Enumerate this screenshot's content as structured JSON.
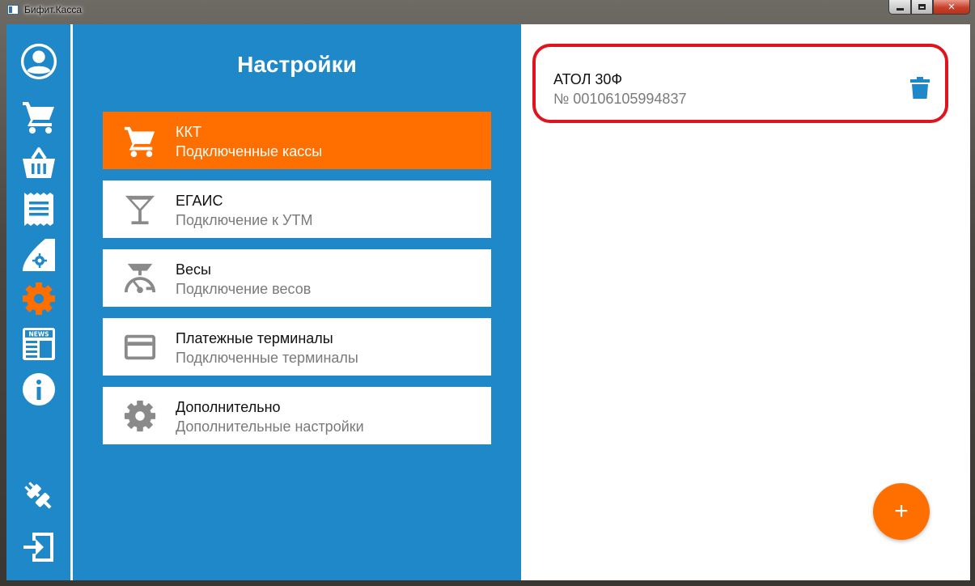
{
  "window": {
    "title": "Бифит.Касса",
    "close_glyph": "✕"
  },
  "colors": {
    "primary": "#1e88c8",
    "accent": "#ff6f00",
    "highlight": "#e0141e",
    "muted_text": "#7a7a7a"
  },
  "sidebar": {
    "items": [
      {
        "icon": "account-icon",
        "active": false
      },
      {
        "icon": "cart-icon",
        "active": false
      },
      {
        "icon": "basket-icon",
        "active": false
      },
      {
        "icon": "receipt-icon",
        "active": false
      },
      {
        "icon": "reports-icon",
        "active": false
      },
      {
        "icon": "gear-icon",
        "active": true
      },
      {
        "icon": "news-icon",
        "active": false
      },
      {
        "icon": "info-icon",
        "active": false
      }
    ],
    "bottom_items": [
      {
        "icon": "plug-icon"
      },
      {
        "icon": "logout-icon"
      }
    ]
  },
  "settings": {
    "title": "Настройки",
    "items": [
      {
        "icon": "cart-icon",
        "title": "ККТ",
        "subtitle": "Подключенные кассы",
        "active": true
      },
      {
        "icon": "cocktail-icon",
        "title": "ЕГАИС",
        "subtitle": "Подключение к УТМ",
        "active": false
      },
      {
        "icon": "scales-icon",
        "title": "Весы",
        "subtitle": "Подключение весов",
        "active": false
      },
      {
        "icon": "credit-card-icon",
        "title": "Платежные терминалы",
        "subtitle": "Подключенные терминалы",
        "active": false
      },
      {
        "icon": "gear-icon",
        "title": "Дополнительно",
        "subtitle": "Дополнительные настройки",
        "active": false
      }
    ]
  },
  "content": {
    "device": {
      "name": "АТОЛ 30Ф",
      "serial": "№ 00106105994837"
    },
    "add_label": "+"
  }
}
